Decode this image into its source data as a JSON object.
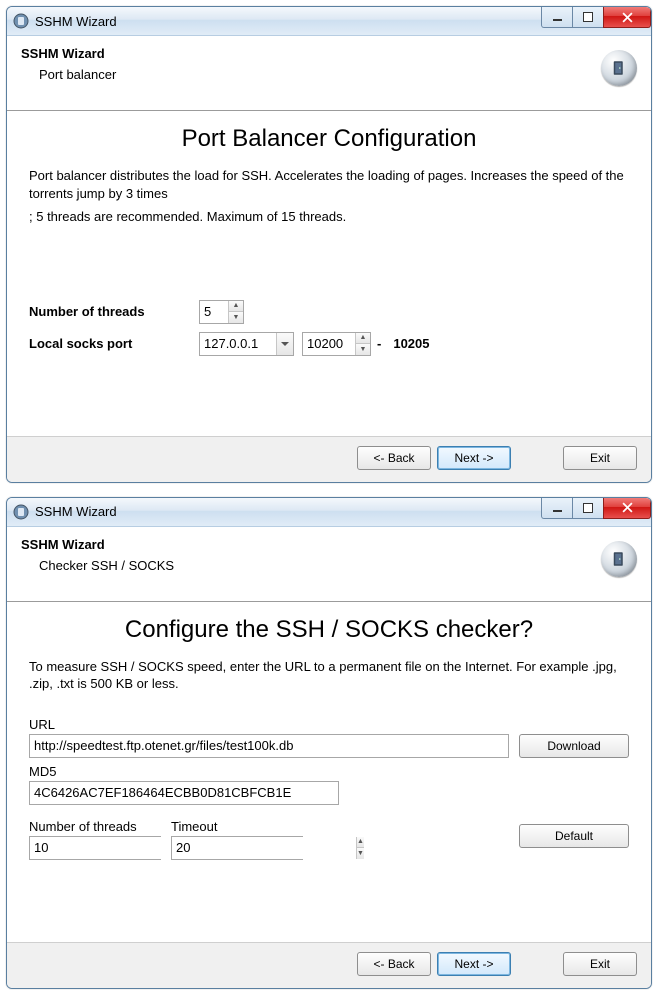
{
  "window1": {
    "titlebar": "SSHM Wizard",
    "header_title": "SSHM Wizard",
    "header_sub": "Port balancer",
    "main_title": "Port Balancer Configuration",
    "desc_line1": "Port balancer distributes the load for SSH. Accelerates the loading of pages. Increases the speed of the torrents jump by 3 times",
    "desc_line2": "; 5 threads are recommended. Maximum of 15 threads.",
    "threads_label": "Number of threads",
    "threads_value": "5",
    "localsocks_label": "Local socks port",
    "localsocks_host": "127.0.0.1",
    "localsocks_port_start": "10200",
    "localsocks_dash": "-",
    "localsocks_port_end": "10205",
    "btn_back": "<- Back",
    "btn_next": "Next ->",
    "btn_exit": "Exit"
  },
  "window2": {
    "titlebar": "SSHM Wizard",
    "header_title": "SSHM Wizard",
    "header_sub": "Checker SSH / SOCKS",
    "main_title": "Configure the SSH / SOCKS checker?",
    "desc": "To measure SSH / SOCKS speed, enter the URL to a permanent file on the Internet. For example .jpg, .zip, .txt is 500 KB or less.",
    "url_label": "URL",
    "url_value": "http://speedtest.ftp.otenet.gr/files/test100k.db",
    "btn_download": "Download",
    "md5_label": "MD5",
    "md5_value": "4C6426AC7EF186464ECBB0D81CBFCB1E",
    "threads_label": "Number of threads",
    "threads_value": "10",
    "timeout_label": "Timeout",
    "timeout_value": "20",
    "btn_default": "Default",
    "btn_back": "<- Back",
    "btn_next": "Next ->",
    "btn_exit": "Exit"
  }
}
